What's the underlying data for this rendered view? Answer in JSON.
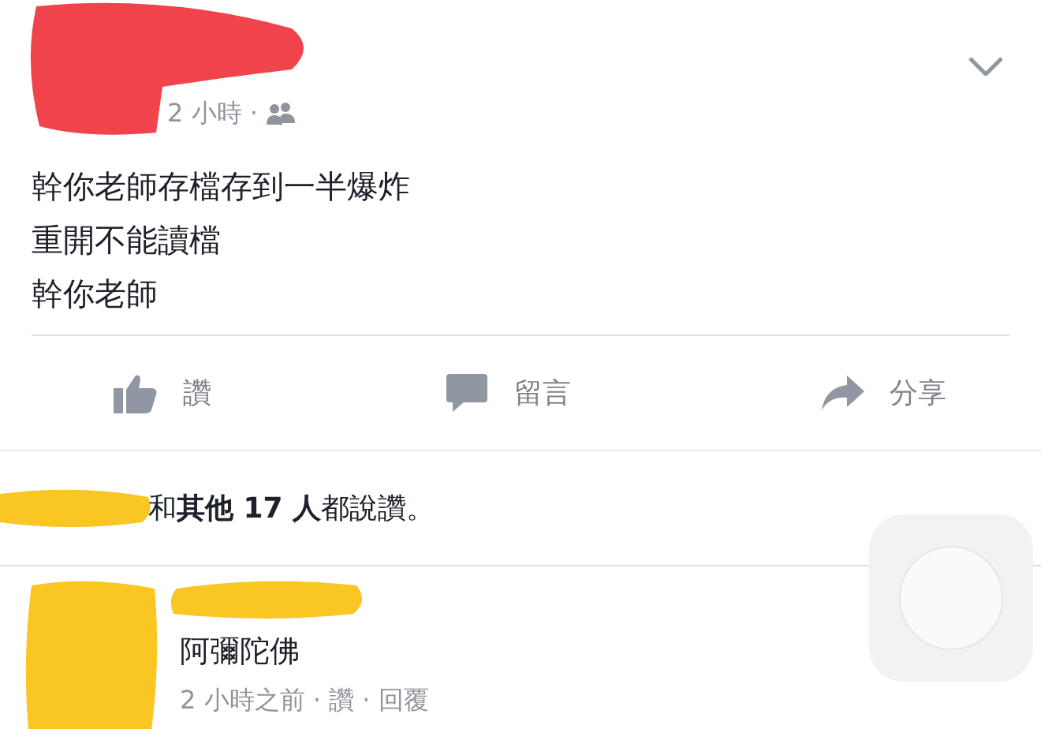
{
  "post": {
    "time": "2 小時 ·",
    "lines": [
      "幹你老師存檔存到一半爆炸",
      "重開不能讀檔",
      "幹你老師"
    ]
  },
  "actions": [
    {
      "kind": "like",
      "label": "讚"
    },
    {
      "kind": "comment",
      "label": "留言"
    },
    {
      "kind": "share",
      "label": "分享"
    }
  ],
  "likes": {
    "text": "和**其他 17 人**都說讚。"
  },
  "comment": {
    "text": "阿彌陀佛",
    "meta": "2 小時之前 · 讚 · 回覆"
  }
}
